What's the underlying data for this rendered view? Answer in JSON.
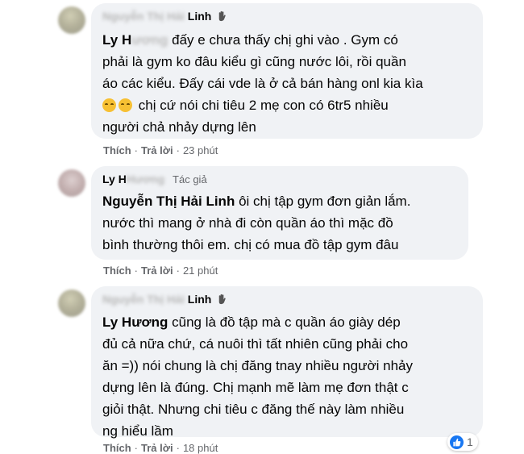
{
  "comments": [
    {
      "author_first": "Nguyễn Thị Hải",
      "author_last": "Linh",
      "mention_first": "Ly",
      "mention_rest_visible": "H",
      "mention_blurred": "ương",
      "lines": [
        "đấy e chưa thấy chị ghi vào . Gym có",
        "phải là gym ko đâu kiểu gì cũng nước lôi, rồi quần",
        "áo các kiểu. Đấy cái vde là ở cả bán hàng onl kia kìa",
        "chị cứ nói chi tiêu 2 mẹ con có 6tr5 nhiều",
        "người chả nhảy dựng lên"
      ],
      "like": "Thích",
      "reply": "Trả lời",
      "time": "23 phút"
    },
    {
      "author_first": "Ly",
      "author_blurred": "Hương",
      "author_last_visible": "H",
      "author_badge": "Tác giả",
      "mention": "Nguyễn Thị Hải Linh",
      "lines": [
        "ôi chị tập gym đơn giản lắm.",
        "nước thì mang ở nhà đi còn quần áo thì mặc đồ",
        "bình thường thôi em. chị có mua đồ tập gym đâu"
      ],
      "like": "Thích",
      "reply": "Trả lời",
      "time": "21 phút"
    },
    {
      "author_first": "Nguyễn Thị Hải",
      "author_last": "Linh",
      "mention": "Ly Hương",
      "lines": [
        "cũng là đồ tập mà c quần áo giày dép",
        "đủ cả nữa chứ, cá nuôi thì tất nhiên cũng phải cho",
        "ăn =)) nói chung là chị đăng tnay nhiều người nhảy",
        "dựng lên là đúng. Chị mạnh mẽ làm mẹ đơn thật c",
        "giỏi thật. Nhưng chi tiêu c đăng thế này làm nhiều",
        "ng hiểu lầm"
      ],
      "like": "Thích",
      "reply": "Trả lời",
      "time": "18 phút",
      "reaction_count": "1"
    }
  ],
  "colors": {
    "bubble": "#f0f2f5",
    "meta": "#65676b",
    "like_blue": "#1877f2"
  }
}
